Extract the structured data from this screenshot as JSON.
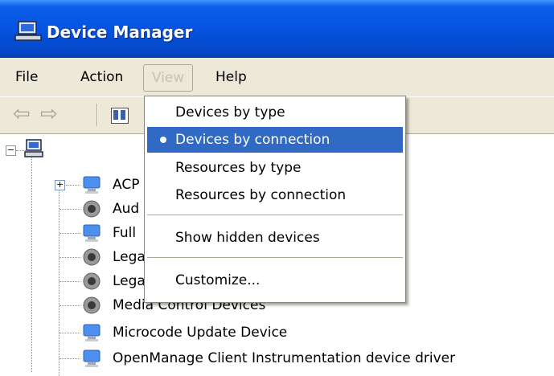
{
  "window": {
    "title": "Device Manager"
  },
  "menubar": {
    "items": [
      "File",
      "Action",
      "View",
      "Help"
    ]
  },
  "view_menu": {
    "items": [
      {
        "label": "Devices by type",
        "selected": false,
        "checked": false
      },
      {
        "label": "Devices by connection",
        "selected": true,
        "checked": true
      },
      {
        "label": "Resources by type",
        "selected": false,
        "checked": false
      },
      {
        "label": "Resources by connection",
        "selected": false,
        "checked": false
      },
      {
        "label": "Show hidden devices",
        "selected": false,
        "checked": false
      },
      {
        "label": "Customize...",
        "selected": false,
        "checked": false
      }
    ]
  },
  "tree": {
    "root_label": "",
    "rows": [
      {
        "label": "ACP",
        "icon": "monitor-icon"
      },
      {
        "label": "Aud",
        "icon": "speaker-icon"
      },
      {
        "label": "Full",
        "icon": "monitor-icon"
      },
      {
        "label": "Lega",
        "icon": "speaker-icon"
      },
      {
        "label": "Lega",
        "icon": "speaker-icon"
      },
      {
        "label": "Media Control Devices",
        "icon": "speaker-icon"
      },
      {
        "label": "Microcode Update Device",
        "icon": "monitor-icon"
      },
      {
        "label": "OpenManage Client Instrumentation device driver",
        "icon": "monitor-icon"
      }
    ]
  },
  "colors": {
    "titlebar": "#0553e0",
    "menu_highlight": "#316ac5",
    "chrome": "#ece9d8"
  }
}
